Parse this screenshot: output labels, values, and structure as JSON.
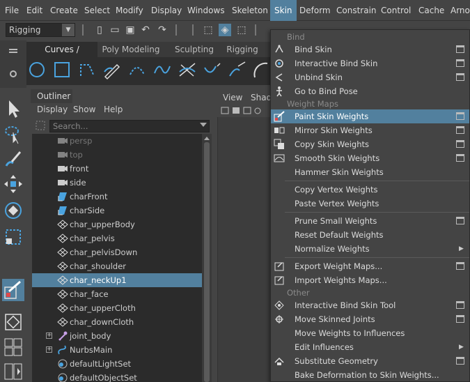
{
  "menubar": {
    "items": [
      "File",
      "Edit",
      "Create",
      "Select",
      "Modify",
      "Display",
      "Windows",
      "Skeleton",
      "Skin",
      "Deform",
      "Constrain",
      "Control",
      "Cache",
      "Arnol"
    ],
    "active": "Skin"
  },
  "statusline": {
    "mode": "Rigging"
  },
  "shelf": {
    "tabs": [
      "Curves / Surfaces",
      "Poly Modeling",
      "Sculpting",
      "Rigging"
    ],
    "active_tab": "Curves / Surfaces"
  },
  "outliner": {
    "tab": "Outliner",
    "menu": [
      "Display",
      "Show",
      "Help"
    ],
    "search_placeholder": "Search...",
    "rows": [
      {
        "label": "persp",
        "icon": "camera-icon",
        "dim": true
      },
      {
        "label": "top",
        "icon": "camera-icon",
        "dim": true
      },
      {
        "label": "front",
        "icon": "camera-icon",
        "dim": false
      },
      {
        "label": "side",
        "icon": "camera-icon",
        "dim": false
      },
      {
        "label": "charFront",
        "icon": "image-plane-icon",
        "dim": false
      },
      {
        "label": "charSide",
        "icon": "image-plane-icon",
        "dim": false
      },
      {
        "label": "char_upperBody",
        "icon": "mesh-icon",
        "dim": false
      },
      {
        "label": "char_pelvis",
        "icon": "mesh-icon",
        "dim": false
      },
      {
        "label": "char_pelvisDown",
        "icon": "mesh-icon",
        "dim": false
      },
      {
        "label": "char_shoulder",
        "icon": "mesh-icon",
        "dim": false
      },
      {
        "label": "char_neckUp1",
        "icon": "mesh-icon",
        "dim": false,
        "selected": true
      },
      {
        "label": "char_face",
        "icon": "mesh-icon",
        "dim": false
      },
      {
        "label": "char_upperCloth",
        "icon": "mesh-icon",
        "dim": false
      },
      {
        "label": "char_downCloth",
        "icon": "mesh-icon",
        "dim": false
      },
      {
        "label": "joint_body",
        "icon": "joint-icon",
        "dim": false,
        "expandable": true
      },
      {
        "label": "NurbsMain",
        "icon": "curve-icon",
        "dim": false,
        "expandable": true
      },
      {
        "label": "defaultLightSet",
        "icon": "set-icon",
        "dim": false
      },
      {
        "label": "defaultObjectSet",
        "icon": "set-icon",
        "dim": false
      }
    ]
  },
  "viewport": {
    "menu": [
      "View",
      "Shad"
    ]
  },
  "skin_menu": {
    "sections": [
      {
        "header": "Bind",
        "items": [
          {
            "label": "Bind Skin",
            "option": true,
            "icon": "bind-skin-icon"
          },
          {
            "label": "Interactive Bind Skin",
            "option": true,
            "icon": "interactive-bind-icon"
          },
          {
            "label": "Unbind Skin",
            "option": true,
            "icon": "unbind-skin-icon"
          },
          {
            "label": "Go to Bind Pose",
            "option": false,
            "icon": "bind-pose-icon"
          }
        ]
      },
      {
        "header": "Weight Maps",
        "items": [
          {
            "label": "Paint Skin Weights",
            "option": true,
            "icon": "paint-weights-icon",
            "highlight": true
          },
          {
            "label": "Mirror Skin Weights",
            "option": true,
            "icon": "mirror-weights-icon"
          },
          {
            "label": "Copy Skin Weights",
            "option": true,
            "icon": "copy-weights-icon"
          },
          {
            "label": "Smooth Skin Weights",
            "option": true,
            "icon": "smooth-weights-icon"
          },
          {
            "label": "Hammer Skin Weights",
            "option": false
          },
          {
            "divider": true
          },
          {
            "label": "Copy Vertex Weights",
            "option": false
          },
          {
            "label": "Paste Vertex Weights",
            "option": false
          },
          {
            "divider": true
          },
          {
            "label": "Prune Small Weights",
            "option": true
          },
          {
            "label": "Reset Default Weights",
            "option": false
          },
          {
            "label": "Normalize Weights",
            "option": false,
            "submenu": true
          },
          {
            "divider": true
          },
          {
            "label": "Export Weight Maps...",
            "option": true,
            "icon": "export-maps-icon"
          },
          {
            "label": "Import Weights Maps...",
            "option": false,
            "icon": "import-maps-icon"
          }
        ]
      },
      {
        "header": "Other",
        "items": [
          {
            "label": "Interactive Bind Skin Tool",
            "option": true,
            "icon": "interactive-bind-tool-icon"
          },
          {
            "label": "Move Skinned Joints",
            "option": true,
            "icon": "move-joints-icon"
          },
          {
            "label": "Move Weights to Influences",
            "option": false
          },
          {
            "label": "Edit Influences",
            "option": false,
            "submenu": true
          },
          {
            "label": "Substitute Geometry",
            "option": true,
            "icon": "substitute-geometry-icon"
          },
          {
            "label": "Bake Deformation to Skin Weights...",
            "option": false
          }
        ]
      }
    ]
  },
  "colors": {
    "highlight": "#52809e",
    "bg": "#444444",
    "list_bg": "#2b2b2b"
  }
}
